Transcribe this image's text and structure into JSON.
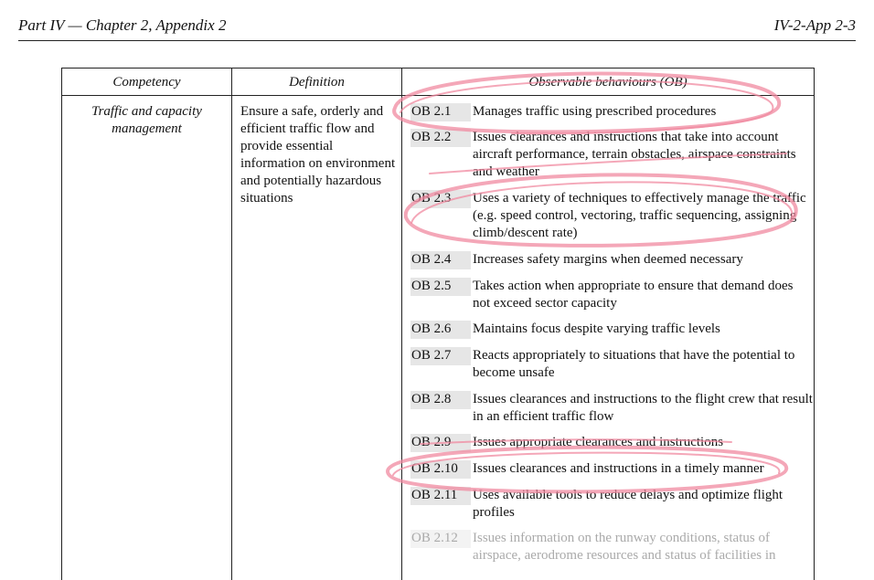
{
  "header": {
    "left": "Part IV — Chapter 2, Appendix 2",
    "right": "IV-2-App 2-3"
  },
  "table": {
    "columns": [
      "Competency",
      "Definition",
      "Observable behaviours (OB)"
    ],
    "competency": "Traffic and capacity management",
    "definition": "Ensure a safe, orderly and efficient traffic flow and provide essential information on environment and potentially hazardous situations",
    "behaviours": [
      {
        "code": "OB 2.1",
        "text": "Manages traffic using prescribed procedures"
      },
      {
        "code": "OB 2.2",
        "text": "Issues clearances and instructions that take into account aircraft performance, terrain obstacles, airspace constraints and weather"
      },
      {
        "code": "OB 2.3",
        "text": "Uses a variety of techniques to effectively manage the traffic (e.g. speed control, vectoring, traffic sequencing, assigning climb/descent rate)"
      },
      {
        "code": "OB 2.4",
        "text": "Increases safety margins when deemed necessary"
      },
      {
        "code": "OB 2.5",
        "text": "Takes action when appropriate to ensure that demand does not exceed sector capacity"
      },
      {
        "code": "OB 2.6",
        "text": "Maintains focus despite varying traffic levels"
      },
      {
        "code": "OB 2.7",
        "text": "Reacts appropriately to situations that have the potential to become unsafe"
      },
      {
        "code": "OB 2.8",
        "text": "Issues clearances and instructions to the flight crew that result in an efficient traffic flow"
      },
      {
        "code": "OB 2.9",
        "text": "Issues appropriate clearances and instructions"
      },
      {
        "code": "OB 2.10",
        "text": "Issues clearances and instructions in a timely manner"
      },
      {
        "code": "OB 2.11",
        "text": "Uses available tools to reduce delays and optimize flight profiles"
      },
      {
        "code": "OB 2.12",
        "text": "Issues information on the runway conditions, status of airspace, aerodrome resources and status of facilities in"
      }
    ]
  },
  "colors": {
    "highlight": "#f08aa0",
    "code_bg": "#e6e6e6",
    "rule": "#222222"
  }
}
